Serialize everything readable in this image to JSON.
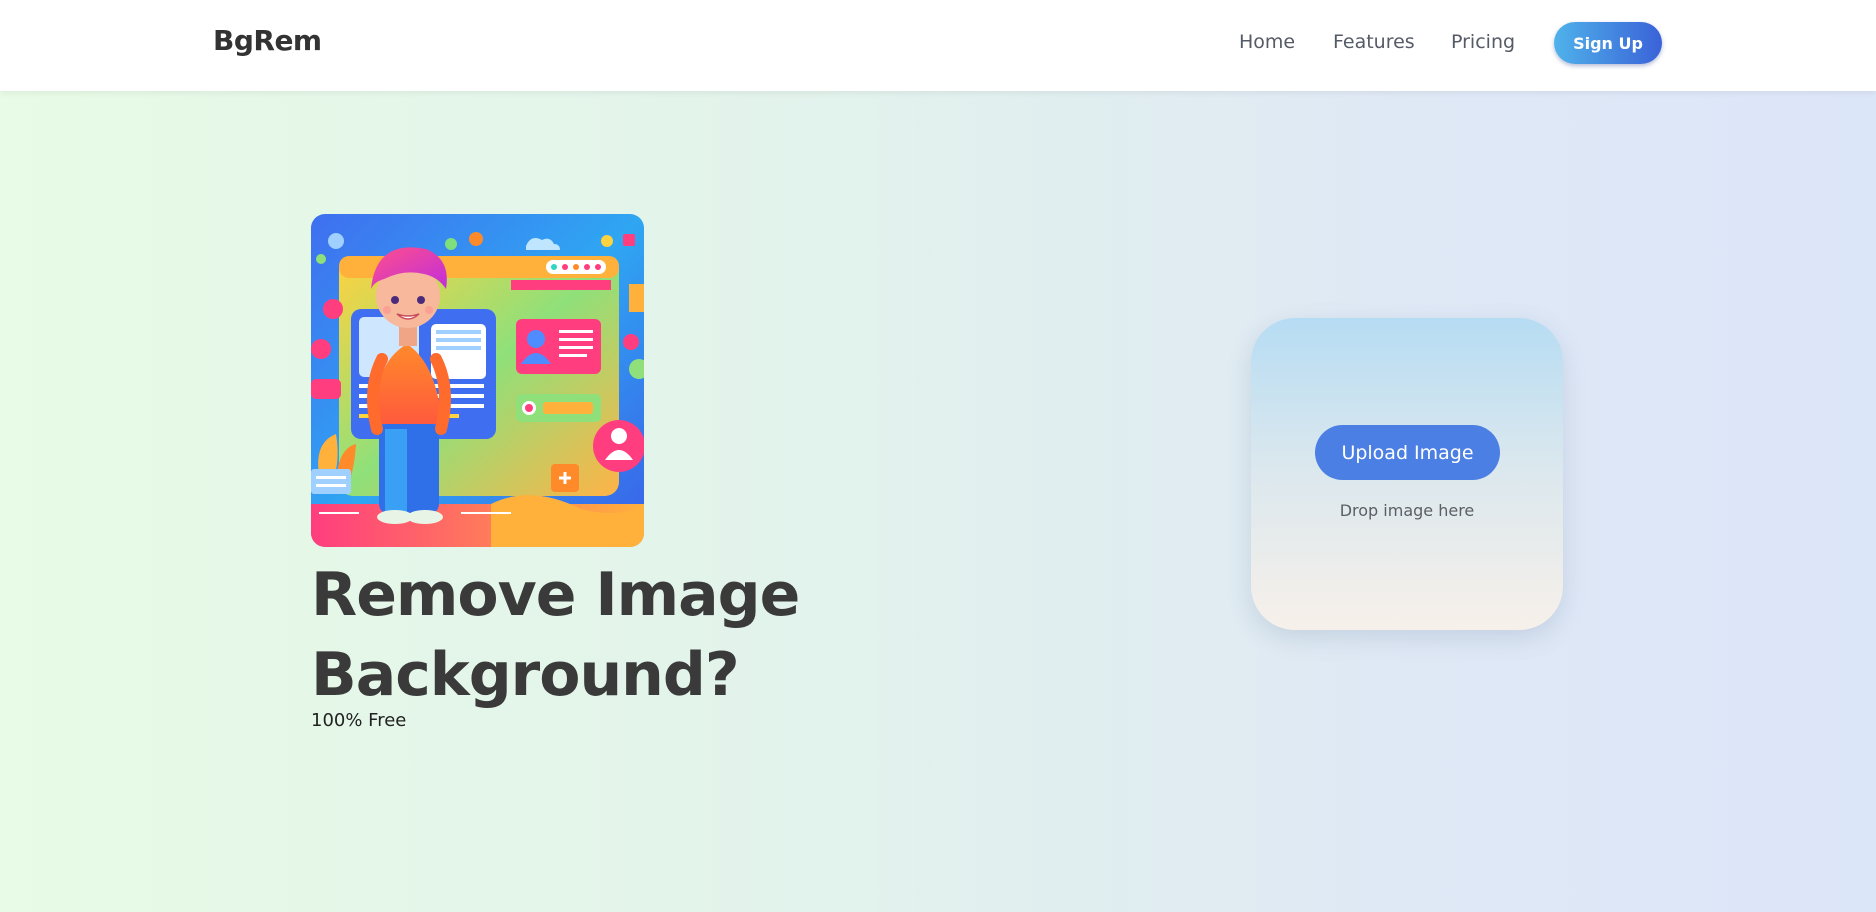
{
  "nav": {
    "brand": "BgRem",
    "links": [
      "Home",
      "Features",
      "Pricing"
    ],
    "signup_label": "Sign Up"
  },
  "hero": {
    "title_line1": "Remove Image",
    "title_line2": "Background?",
    "subtitle": "100% Free",
    "illustration": "person-with-computer-illustration"
  },
  "upload": {
    "button_label": "Upload Image",
    "drop_text": "Drop image here"
  },
  "colors": {
    "accent": "#4b7fe3",
    "signup_gradient_start": "#4fb2ea",
    "signup_gradient_end": "#3a62d8",
    "text_dark": "#3a3a3a"
  }
}
